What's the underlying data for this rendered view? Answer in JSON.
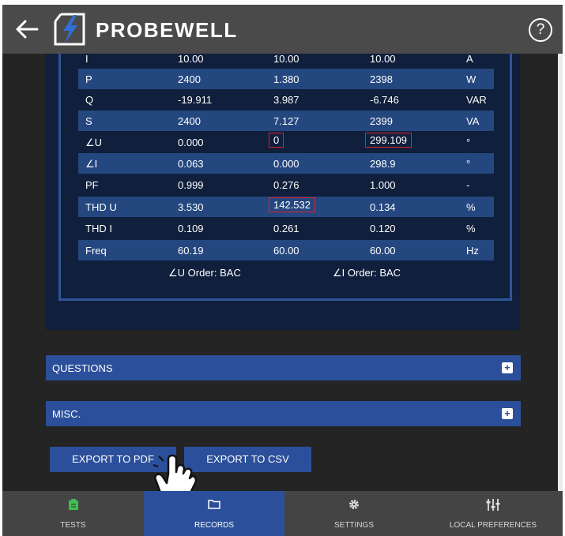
{
  "app": {
    "brand": "PROBEWELL"
  },
  "table": {
    "rows": [
      {
        "label": "I",
        "v1": "10.00",
        "v2": "10.00",
        "v3": "10.00",
        "unit": "A"
      },
      {
        "label": "P",
        "v1": "2400",
        "v2": "1.380",
        "v3": "2398",
        "unit": "W"
      },
      {
        "label": "Q",
        "v1": "-19.911",
        "v2": "3.987",
        "v3": "-6.746",
        "unit": "VAR"
      },
      {
        "label": "S",
        "v1": "2400",
        "v2": "7.127",
        "v3": "2399",
        "unit": "VA"
      },
      {
        "label": "∠U",
        "v1": "0.000",
        "v2": "0",
        "v3": "299.109",
        "unit": "°"
      },
      {
        "label": "∠I",
        "v1": "0.063",
        "v2": "0.000",
        "v3": "298.9",
        "unit": "°"
      },
      {
        "label": "PF",
        "v1": "0.999",
        "v2": "0.276",
        "v3": "1.000",
        "unit": "-"
      },
      {
        "label": "THD U",
        "v1": "3.530",
        "v2": "142.532",
        "v3": "0.134",
        "unit": "%"
      },
      {
        "label": "THD I",
        "v1": "0.109",
        "v2": "0.261",
        "v3": "0.120",
        "unit": "%"
      },
      {
        "label": "Freq",
        "v1": "60.19",
        "v2": "60.00",
        "v3": "60.00",
        "unit": "Hz"
      }
    ],
    "u_order": "∠U Order: BAC",
    "i_order": "∠I Order: BAC"
  },
  "sections": {
    "questions": "QUESTIONS",
    "misc": "MISC."
  },
  "actions": {
    "export_pdf": "EXPORT TO PDF",
    "export_csv": "EXPORT TO CSV"
  },
  "nav": {
    "tests": "TESTS",
    "records": "RECORDS",
    "settings": "SETTINGS",
    "local_preferences": "LOCAL PREFERENCES",
    "active": "records"
  },
  "colors": {
    "accent": "#2b4f9a",
    "panel": "#0f1f3c",
    "highlight_border": "#e0202c",
    "tests_icon": "#3fbf4f"
  },
  "icons": {
    "back": "arrow-left-icon",
    "help": "question-circle-icon",
    "tests": "clipboard-icon",
    "records": "folder-icon",
    "settings": "gear-icon",
    "local_preferences": "sliders-icon"
  }
}
